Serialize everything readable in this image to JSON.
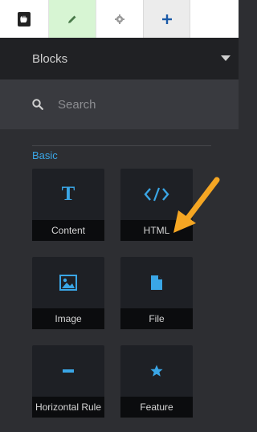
{
  "toolbar": {
    "logo_icon": "concrete5-hand-logo-icon",
    "edit_icon": "pencil-icon",
    "settings_icon": "gear-icon",
    "add_icon": "plus-icon",
    "colors": {
      "edit_active_bg": "#d7f5d3",
      "add_icon": "#1a5aa8"
    }
  },
  "panel": {
    "title": "Blocks",
    "dropdown_icon": "caret-down-icon"
  },
  "search": {
    "placeholder": "Search",
    "value": ""
  },
  "category": {
    "label": "Basic",
    "color": "#3aa6e6"
  },
  "blocks": [
    {
      "label": "Content",
      "icon": "text-t-icon"
    },
    {
      "label": "HTML",
      "icon": "code-icon"
    },
    {
      "label": "Image",
      "icon": "image-icon"
    },
    {
      "label": "File",
      "icon": "file-icon"
    },
    {
      "label": "Horizontal Rule",
      "icon": "horizontal-rule-icon"
    },
    {
      "label": "Feature",
      "icon": "star-icon"
    }
  ],
  "annotation": {
    "icon": "orange-arrow-icon",
    "color": "#f5a623"
  }
}
